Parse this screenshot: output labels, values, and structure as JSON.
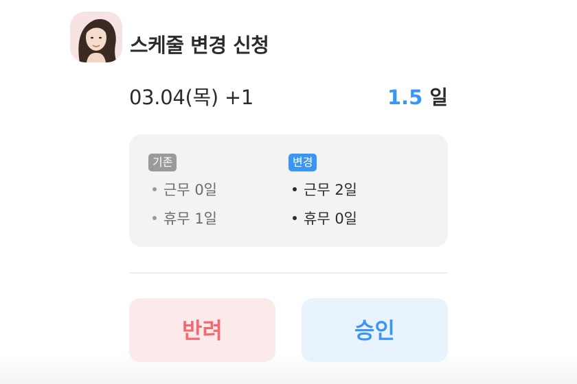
{
  "header": {
    "avatar_icon": "user-photo-avatar",
    "title": "스케줄 변경 신청"
  },
  "request": {
    "date": "03.04(목)  +1",
    "days_value": "1.5",
    "days_unit": "일"
  },
  "comparison": {
    "before": {
      "tag": "기존",
      "items": [
        "근무 0일",
        "휴무 1일"
      ]
    },
    "after": {
      "tag": "변경",
      "items": [
        "근무 2일",
        "휴무 0일"
      ]
    }
  },
  "actions": {
    "reject_label": "반려",
    "approve_label": "승인"
  },
  "colors": {
    "accent_blue": "#3a96f2",
    "reject_red": "#f06a72",
    "reject_bg": "#fce9ea",
    "approve_bg": "#e8f3fe",
    "card_bg": "#f3f3f3"
  }
}
